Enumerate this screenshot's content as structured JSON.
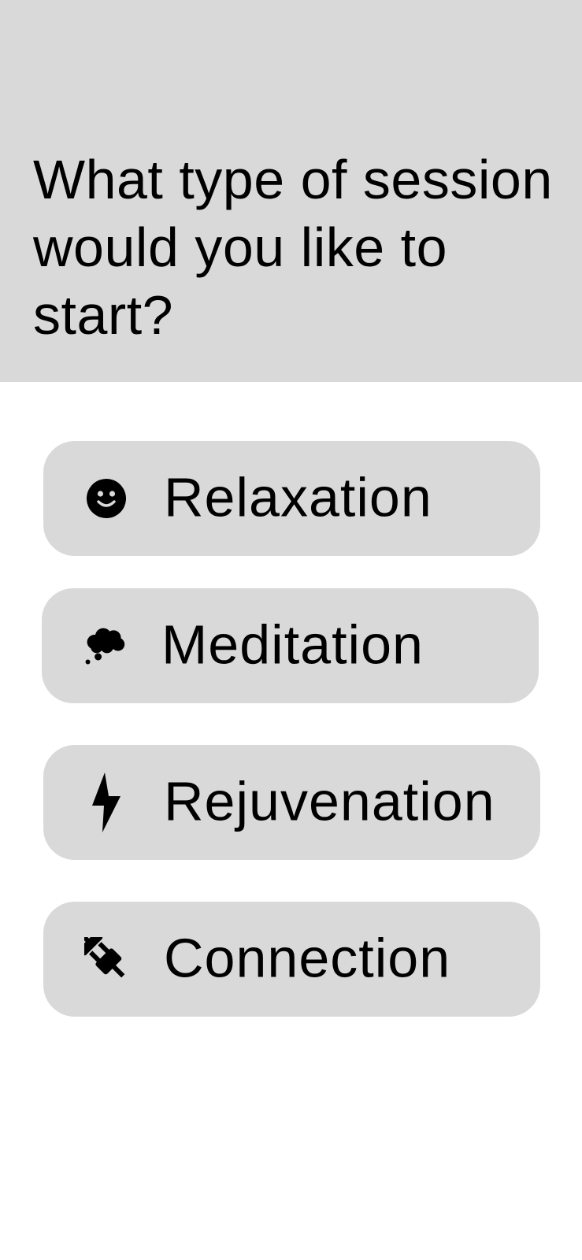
{
  "header": {
    "title": "What type of session would you like to start?"
  },
  "options": [
    {
      "label": "Relaxation",
      "icon": "smiley-face-icon"
    },
    {
      "label": "Meditation",
      "icon": "thought-cloud-icon"
    },
    {
      "label": "Rejuvenation",
      "icon": "lightning-bolt-icon"
    },
    {
      "label": "Connection",
      "icon": "plug-icon"
    }
  ],
  "colors": {
    "header_background": "#d9d9d9",
    "button_background": "#d9d9d9",
    "page_background": "#ffffff",
    "text": "#000000"
  }
}
